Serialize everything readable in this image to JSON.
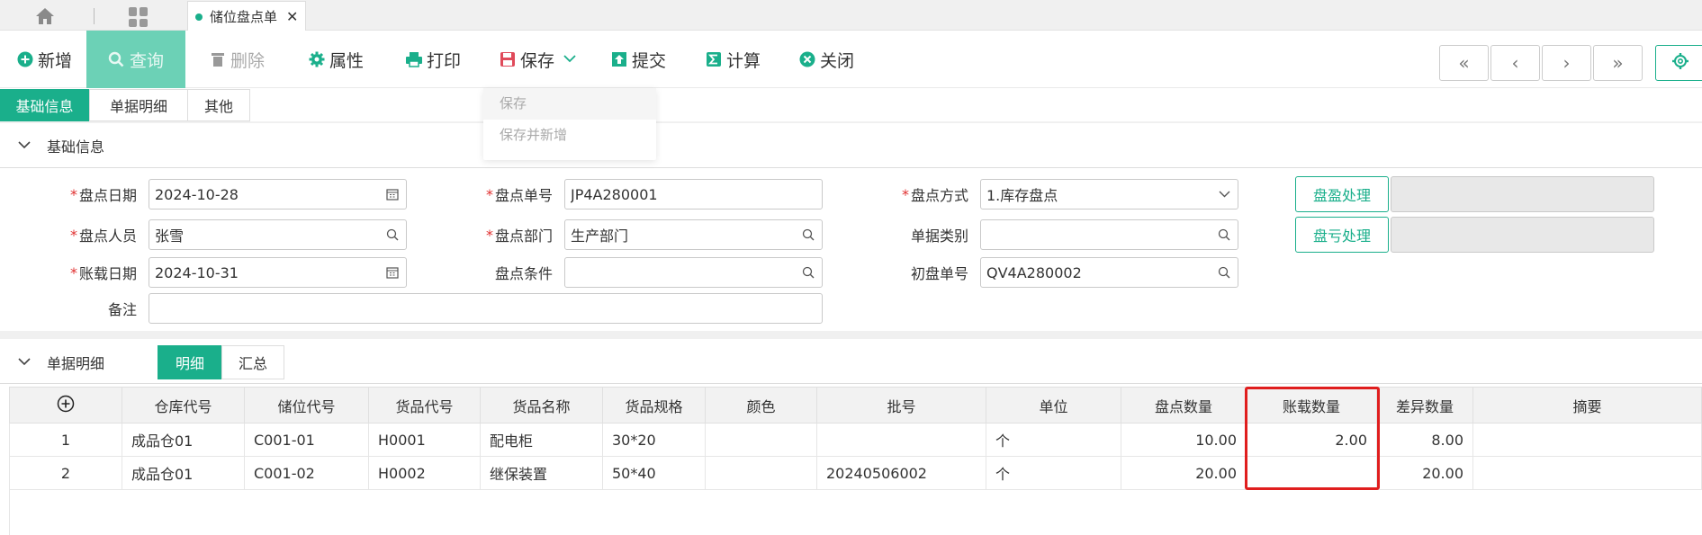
{
  "tabs": {
    "active_doc": "储位盘点单"
  },
  "toolbar": {
    "add": "新增",
    "query": "查询",
    "delete": "删除",
    "props": "属性",
    "print": "打印",
    "save": "保存",
    "submit": "提交",
    "calc": "计算",
    "close": "关闭",
    "nav": [
      "«",
      "‹",
      "›",
      "»"
    ]
  },
  "save_menu": {
    "items": [
      "保存",
      "保存并新增"
    ]
  },
  "subtabs": [
    "基础信息",
    "单据明细",
    "其他"
  ],
  "basic": {
    "section_title": "基础信息",
    "date_label": "盘点日期",
    "date_value": "2024-10-28",
    "no_label": "盘点单号",
    "no_value": "JP4A280001",
    "method_label": "盘点方式",
    "method_value": "1.库存盘点",
    "person_label": "盘点人员",
    "person_value": "张雪",
    "dept_label": "盘点部门",
    "dept_value": "生产部门",
    "type_label": "单据类别",
    "type_value": "",
    "acct_label": "账载日期",
    "acct_value": "2024-10-31",
    "cond_label": "盘点条件",
    "cond_value": "",
    "init_label": "初盘单号",
    "init_value": "QV4A280002",
    "remark_label": "备注",
    "remark_value": "",
    "gain_btn": "盘盈处理",
    "loss_btn": "盘亏处理"
  },
  "detail": {
    "section_title": "单据明细",
    "tabs": [
      "明细",
      "汇总"
    ],
    "columns": [
      "仓库代号",
      "储位代号",
      "货品代号",
      "货品名称",
      "货品规格",
      "颜色",
      "批号",
      "单位",
      "盘点数量",
      "账载数量",
      "差异数量",
      "摘要"
    ],
    "rows": [
      {
        "idx": "1",
        "wh": "成品仓01",
        "loc": "C001-01",
        "code": "H0001",
        "name": "配电柜",
        "spec": "30*20",
        "color": "",
        "batch": "",
        "unit": "个",
        "count": "10.00",
        "book": "2.00",
        "diff": "8.00",
        "memo": ""
      },
      {
        "idx": "2",
        "wh": "成品仓01",
        "loc": "C001-02",
        "code": "H0002",
        "name": "继保装置",
        "spec": "50*40",
        "color": "",
        "batch": "20240506002",
        "unit": "个",
        "count": "20.00",
        "book": "",
        "diff": "20.00",
        "memo": ""
      }
    ]
  },
  "colors": {
    "accent": "#1aaf8b",
    "highlight": "#e01e1e"
  }
}
